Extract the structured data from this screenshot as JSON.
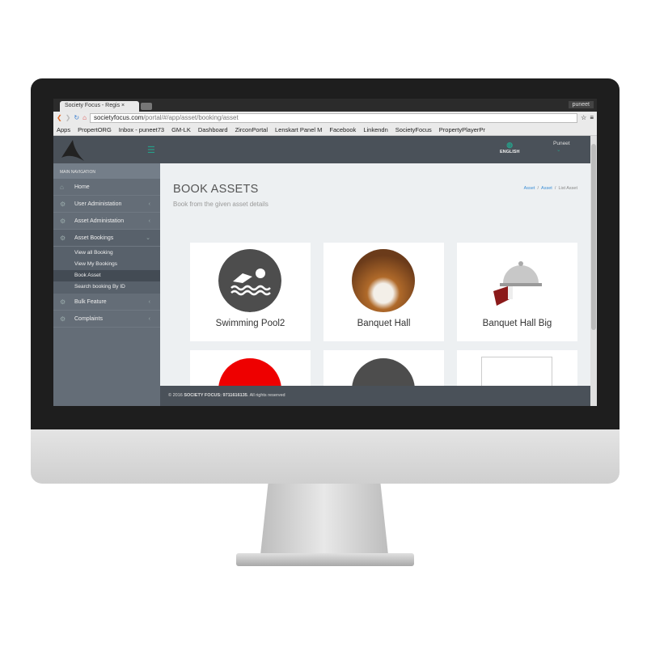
{
  "browser": {
    "tab_title": "Society Focus - Regis",
    "profile": "puneet",
    "url_host": "societyfocus.com",
    "url_path": "/portal/#/app/asset/booking/asset",
    "bookmarks": [
      "Apps",
      "PropertORG",
      "Inbox - puneet73",
      "GM-LK",
      "Dashboard",
      "ZirconPortal",
      "Lenskart Panel M",
      "Facebook",
      "Linkendn",
      "SocietyFocus",
      "PropertyPlayerPr"
    ]
  },
  "header": {
    "language": "ENGLISH",
    "user": "Puneet"
  },
  "sidebar": {
    "heading": "MAIN NAVIGATION",
    "items": [
      {
        "label": "Home"
      },
      {
        "label": "User Administation"
      },
      {
        "label": "Asset Administation"
      },
      {
        "label": "Asset Bookings"
      },
      {
        "label": "Bulk Feature"
      },
      {
        "label": "Complaints"
      }
    ],
    "sub_items": [
      "View all Booking",
      "View My Bookings",
      "Book Asset",
      "Search booking By ID"
    ]
  },
  "page": {
    "title": "BOOK ASSETS",
    "subtitle": "Book from the given asset details",
    "breadcrumb": [
      "Asset",
      "Asset",
      "List Asset"
    ]
  },
  "assets": [
    {
      "name": "Swimming Pool2"
    },
    {
      "name": "Banquet Hall"
    },
    {
      "name": "Banquet Hall Big"
    }
  ],
  "footer": {
    "prefix": "© 2016 ",
    "brand": "SOCIETY FOCUS: 9711616135",
    "suffix": ". All rights reserved"
  }
}
